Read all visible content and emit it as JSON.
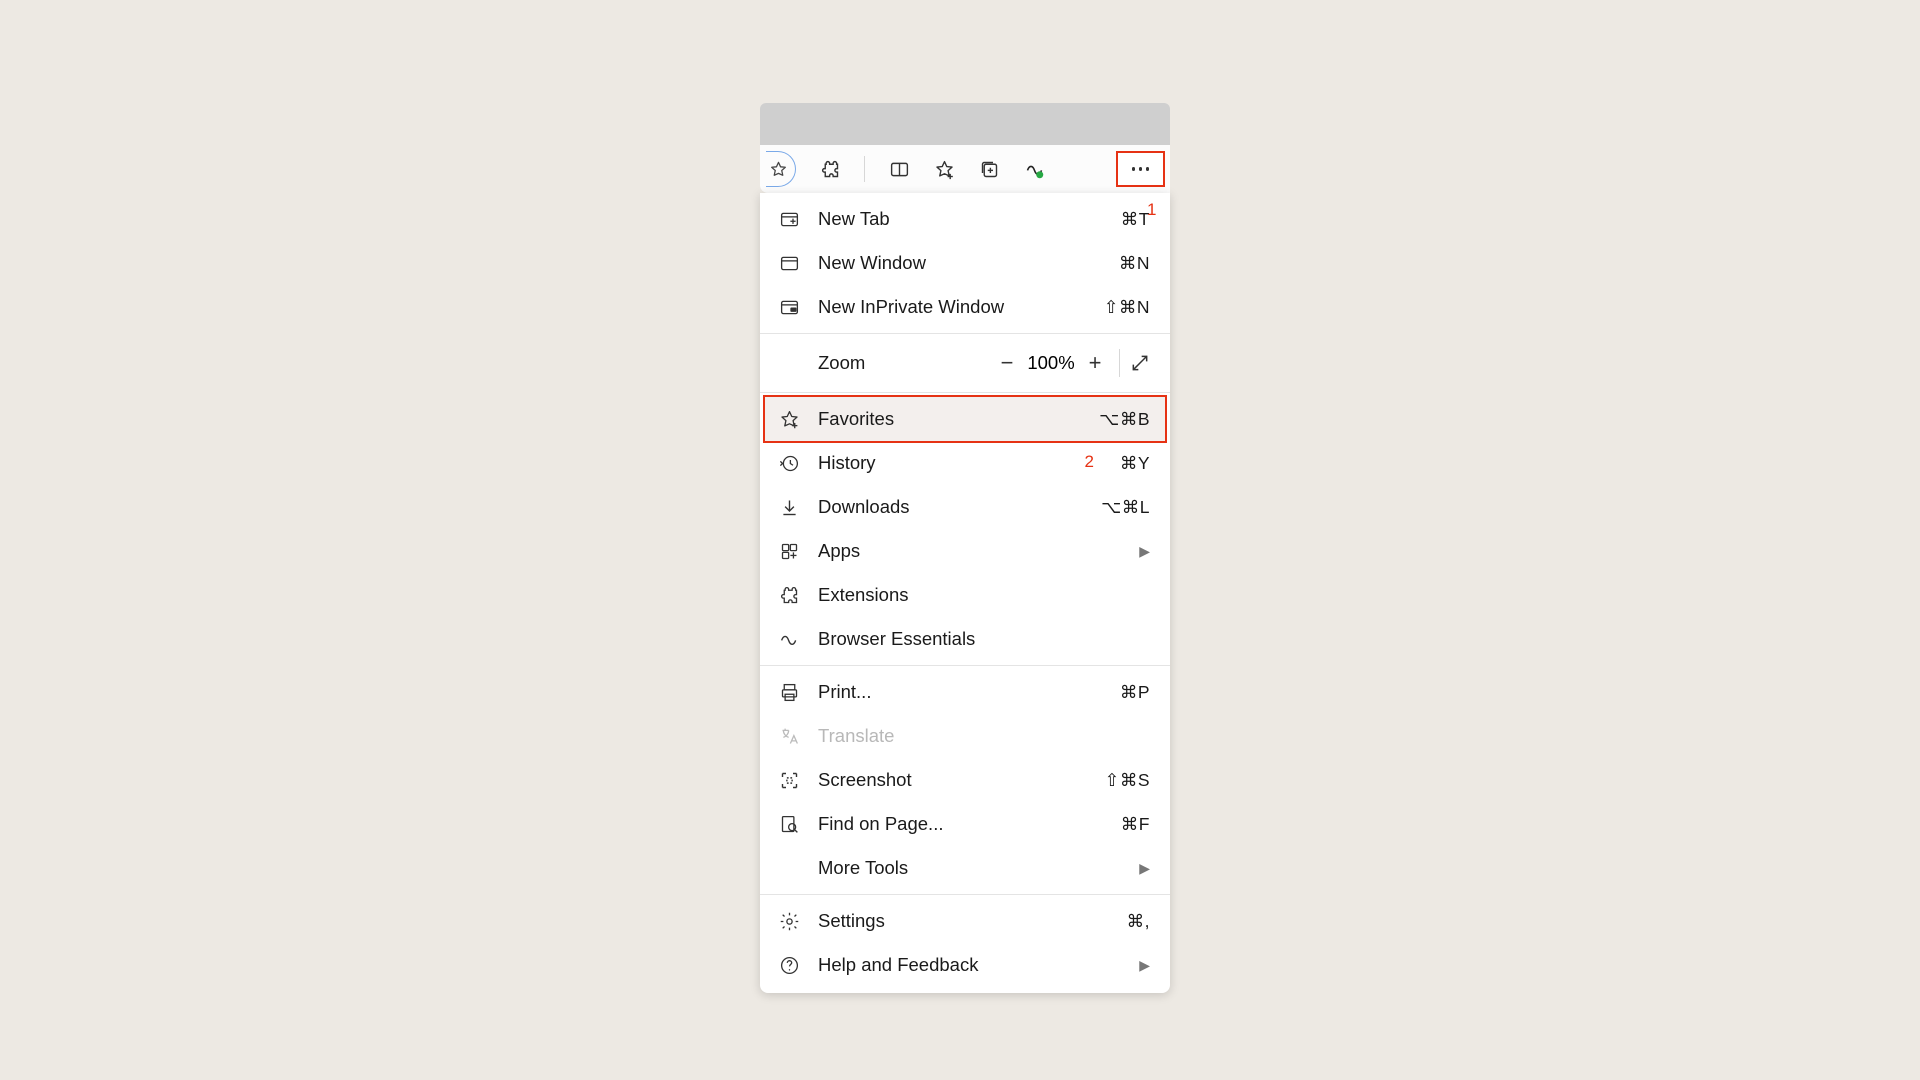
{
  "toolbar": {
    "icons": [
      "star-outline",
      "puzzle",
      "split-screen",
      "star-add",
      "collections",
      "essentials-badge"
    ],
    "more": "more"
  },
  "annotations": {
    "a1": "1",
    "a2": "2"
  },
  "menu": {
    "newtab": {
      "label": "New Tab",
      "shortcut": "⌘T"
    },
    "newwindow": {
      "label": "New Window",
      "shortcut": "⌘N"
    },
    "inprivate": {
      "label": "New InPrivate Window",
      "shortcut": "⇧⌘N"
    },
    "zoom": {
      "label": "Zoom",
      "value": "100%"
    },
    "favorites": {
      "label": "Favorites",
      "shortcut": "⌥⌘B"
    },
    "history": {
      "label": "History",
      "shortcut": "⌘Y"
    },
    "downloads": {
      "label": "Downloads",
      "shortcut": "⌥⌘L"
    },
    "apps": {
      "label": "Apps"
    },
    "extensions": {
      "label": "Extensions"
    },
    "essentials": {
      "label": "Browser Essentials"
    },
    "print": {
      "label": "Print...",
      "shortcut": "⌘P"
    },
    "translate": {
      "label": "Translate"
    },
    "screenshot": {
      "label": "Screenshot",
      "shortcut": "⇧⌘S"
    },
    "find": {
      "label": "Find on Page...",
      "shortcut": "⌘F"
    },
    "moretools": {
      "label": "More Tools"
    },
    "settings": {
      "label": "Settings",
      "shortcut": "⌘,"
    },
    "help": {
      "label": "Help and Feedback"
    }
  }
}
